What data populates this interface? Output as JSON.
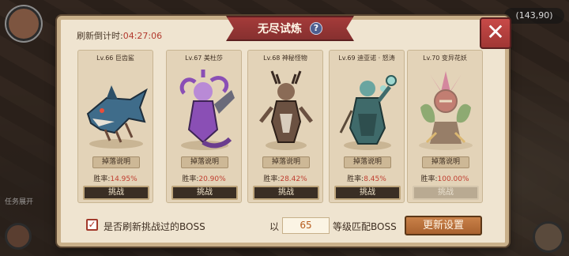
{
  "window": {
    "title": "无尽试炼",
    "refresh_label": "刷新倒计时:",
    "refresh_timer": "04:27:06",
    "close_glyph": "✕",
    "help_glyph": "?"
  },
  "hud": {
    "coords": "(143,90)",
    "task_expand": "任务展开"
  },
  "bosses": [
    {
      "name": "Lv.66 巨齿鲨",
      "drop_label": "掉落说明",
      "rate_label": "胜率:",
      "rate": "14.95%",
      "fight_label": "挑战",
      "enabled": true,
      "color": "#3f6c8a"
    },
    {
      "name": "Lv.67 美杜莎",
      "drop_label": "掉落说明",
      "rate_label": "胜率:",
      "rate": "20.90%",
      "fight_label": "挑战",
      "enabled": true,
      "color": "#8a4fb5"
    },
    {
      "name": "Lv.68 神秘怪物",
      "drop_label": "掉落说明",
      "rate_label": "胜率:",
      "rate": "28.42%",
      "fight_label": "挑战",
      "enabled": true,
      "color": "#6b5141"
    },
    {
      "name": "Lv.69 迪亚诺 · 怒涛",
      "drop_label": "掉落说明",
      "rate_label": "胜率:",
      "rate": "8.45%",
      "fight_label": "挑战",
      "enabled": true,
      "color": "#3f6a6a"
    },
    {
      "name": "Lv.70 变异花妖",
      "drop_label": "掉落说明",
      "rate_label": "胜率:",
      "rate": "100.00%",
      "fight_label": "挑战",
      "enabled": false,
      "color": "#a83a3a"
    }
  ],
  "footer": {
    "checkbox_checked": true,
    "checkbox_label": "是否刷新挑战过的BOSS",
    "prefix": "以",
    "level_value": "65",
    "suffix": "等级匹配BOSS",
    "update_button": "更新设置"
  }
}
